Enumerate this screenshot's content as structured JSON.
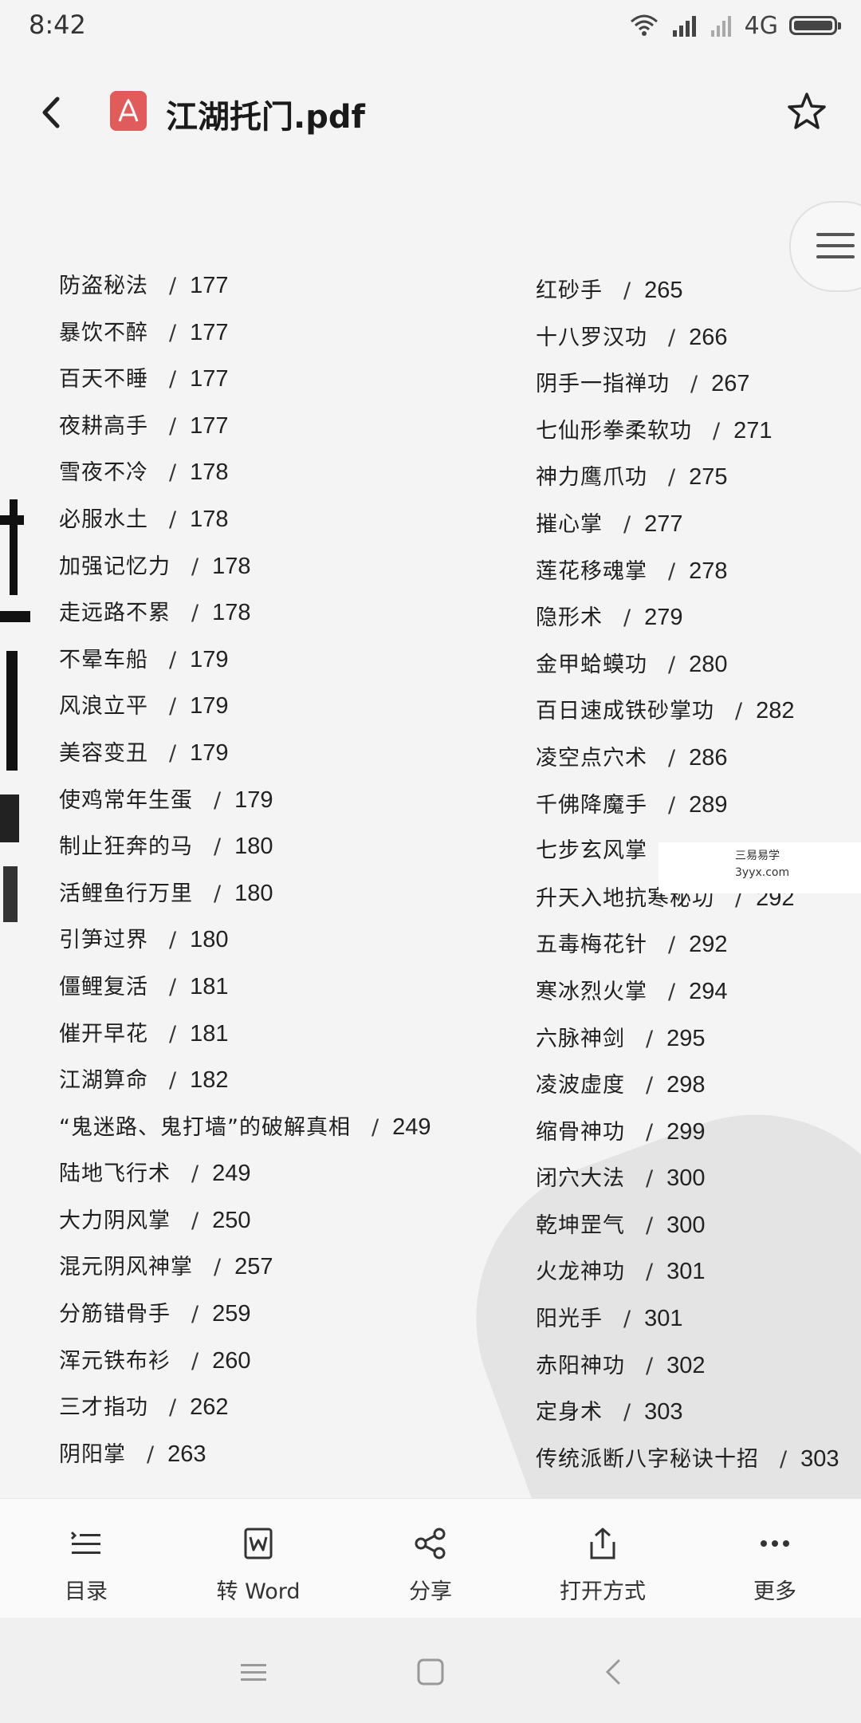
{
  "status": {
    "time": "8:42",
    "network": "4G",
    "battery_level": 0.95
  },
  "header": {
    "title": "江湖托门.pdf"
  },
  "toc_left": [
    {
      "name": "防盗秘法",
      "page": "177"
    },
    {
      "name": "暴饮不醉",
      "page": "177"
    },
    {
      "name": "百天不睡",
      "page": "177"
    },
    {
      "name": "夜耕高手",
      "page": "177"
    },
    {
      "name": "雪夜不冷",
      "page": "178"
    },
    {
      "name": "必服水土",
      "page": "178"
    },
    {
      "name": "加强记忆力",
      "page": "178"
    },
    {
      "name": "走远路不累",
      "page": "178"
    },
    {
      "name": "不晕车船",
      "page": "179"
    },
    {
      "name": "风浪立平",
      "page": "179"
    },
    {
      "name": "美容变丑",
      "page": "179"
    },
    {
      "name": "使鸡常年生蛋",
      "page": "179"
    },
    {
      "name": "制止狂奔的马",
      "page": "180"
    },
    {
      "name": "活鲤鱼行万里",
      "page": "180"
    },
    {
      "name": "引笋过界",
      "page": "180"
    },
    {
      "name": "僵鲤复活",
      "page": "181"
    },
    {
      "name": "催开早花",
      "page": "181"
    },
    {
      "name": "江湖算命",
      "page": "182"
    },
    {
      "name": "“鬼迷路、鬼打墙”的破解真相",
      "page": "249"
    },
    {
      "name": "陆地飞行术",
      "page": "249"
    },
    {
      "name": "大力阴风掌",
      "page": "250"
    },
    {
      "name": "混元阴风神掌",
      "page": "257"
    },
    {
      "name": "分筋错骨手",
      "page": "259"
    },
    {
      "name": "浑元铁布衫",
      "page": "260"
    },
    {
      "name": "三才指功",
      "page": "262"
    },
    {
      "name": "阴阳掌",
      "page": "263"
    }
  ],
  "toc_right": [
    {
      "name": "红砂手",
      "page": "265"
    },
    {
      "name": "十八罗汉功",
      "page": "266"
    },
    {
      "name": "阴手一指禅功",
      "page": "267"
    },
    {
      "name": "七仙形拳柔软功",
      "page": "271"
    },
    {
      "name": "神力鹰爪功",
      "page": "275"
    },
    {
      "name": "摧心掌",
      "page": "277"
    },
    {
      "name": "莲花移魂掌",
      "page": "278"
    },
    {
      "name": "隐形术",
      "page": "279"
    },
    {
      "name": "金甲蛤蟆功",
      "page": "280"
    },
    {
      "name": "百日速成铁砂掌功",
      "page": "282"
    },
    {
      "name": "凌空点穴术",
      "page": "286"
    },
    {
      "name": "千佛降魔手",
      "page": "289"
    },
    {
      "name": "七步玄风掌",
      "page": ""
    },
    {
      "name": "升天入地抗寒秘功",
      "page": "292"
    },
    {
      "name": "五毒梅花针",
      "page": "292"
    },
    {
      "name": "寒冰烈火掌",
      "page": "294"
    },
    {
      "name": "六脉神剑",
      "page": "295"
    },
    {
      "name": "凌波虚度",
      "page": "298"
    },
    {
      "name": "缩骨神功",
      "page": "299"
    },
    {
      "name": "闭穴大法",
      "page": "300"
    },
    {
      "name": "乾坤罡气",
      "page": "300"
    },
    {
      "name": "火龙神功",
      "page": "301"
    },
    {
      "name": "阳光手",
      "page": "301"
    },
    {
      "name": "赤阳神功",
      "page": "302"
    },
    {
      "name": "定身术",
      "page": "303"
    },
    {
      "name": "传统派断八字秘诀十招",
      "page": "303"
    }
  ],
  "watermark": {
    "line1": "三易易学",
    "line2": "3yyx.com"
  },
  "toolbar": [
    {
      "label": "目录",
      "icon": "list-icon"
    },
    {
      "label": "转 Word",
      "icon": "word-convert-icon"
    },
    {
      "label": "分享",
      "icon": "share-icon"
    },
    {
      "label": "打开方式",
      "icon": "open-with-icon"
    },
    {
      "label": "更多",
      "icon": "more-icon"
    }
  ],
  "colors": {
    "pdf_icon": "#e25b5b",
    "background": "#f4f4f4"
  }
}
